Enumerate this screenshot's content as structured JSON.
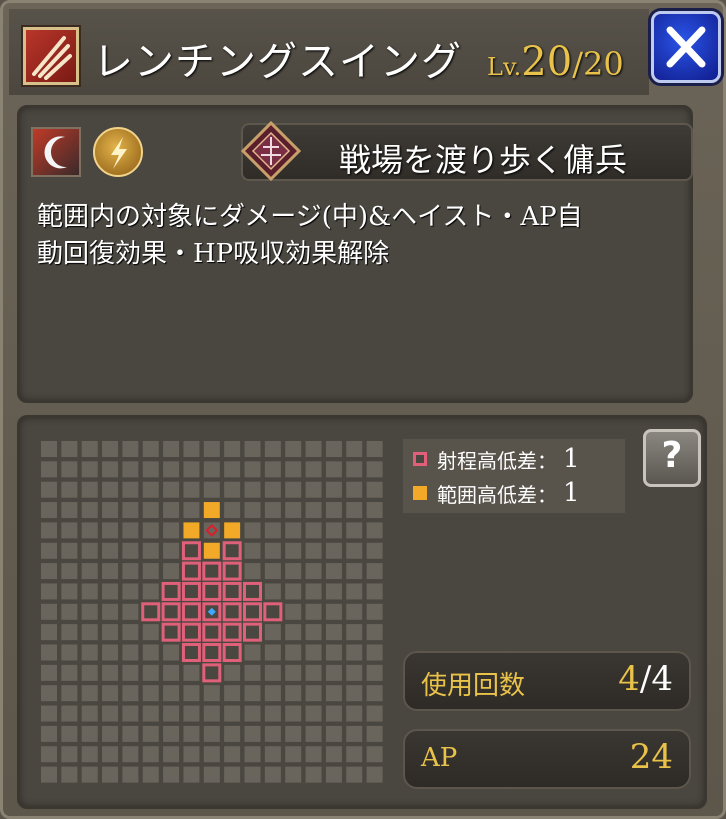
{
  "header": {
    "skill_icon": "claw-slash-icon",
    "title": "レンチングスイング",
    "level_prefix": "Lv.",
    "level_current": "20",
    "level_max": "/20"
  },
  "close_button": {
    "icon": "close-x-icon"
  },
  "info": {
    "attribute_icons": [
      "crescent-slash-icon",
      "lightning-orb-icon"
    ],
    "job_emblem": "mercenary-emblem-icon",
    "job_name": "戦場を渡り歩く傭兵",
    "description_lines": [
      "範囲内の対象にダメージ(中)&ヘイスト・AP自",
      "動回復効果・HP吸収効果解除"
    ]
  },
  "range": {
    "legend": {
      "range_height_label": "射程高低差：",
      "range_height_value": "1",
      "area_height_label": "範囲高低差：",
      "area_height_value": "1"
    },
    "help_icon": "question-mark-icon",
    "uses_label": "使用回数",
    "uses_current": "4",
    "uses_max": "4",
    "ap_label": "AP",
    "ap_value": "24"
  },
  "colors": {
    "accent_gold": "#e9c24a",
    "range_pink": "#e0607a",
    "area_orange": "#f2a928",
    "caster_blue": "#3ea8ff",
    "target_red": "#d8202c"
  }
}
